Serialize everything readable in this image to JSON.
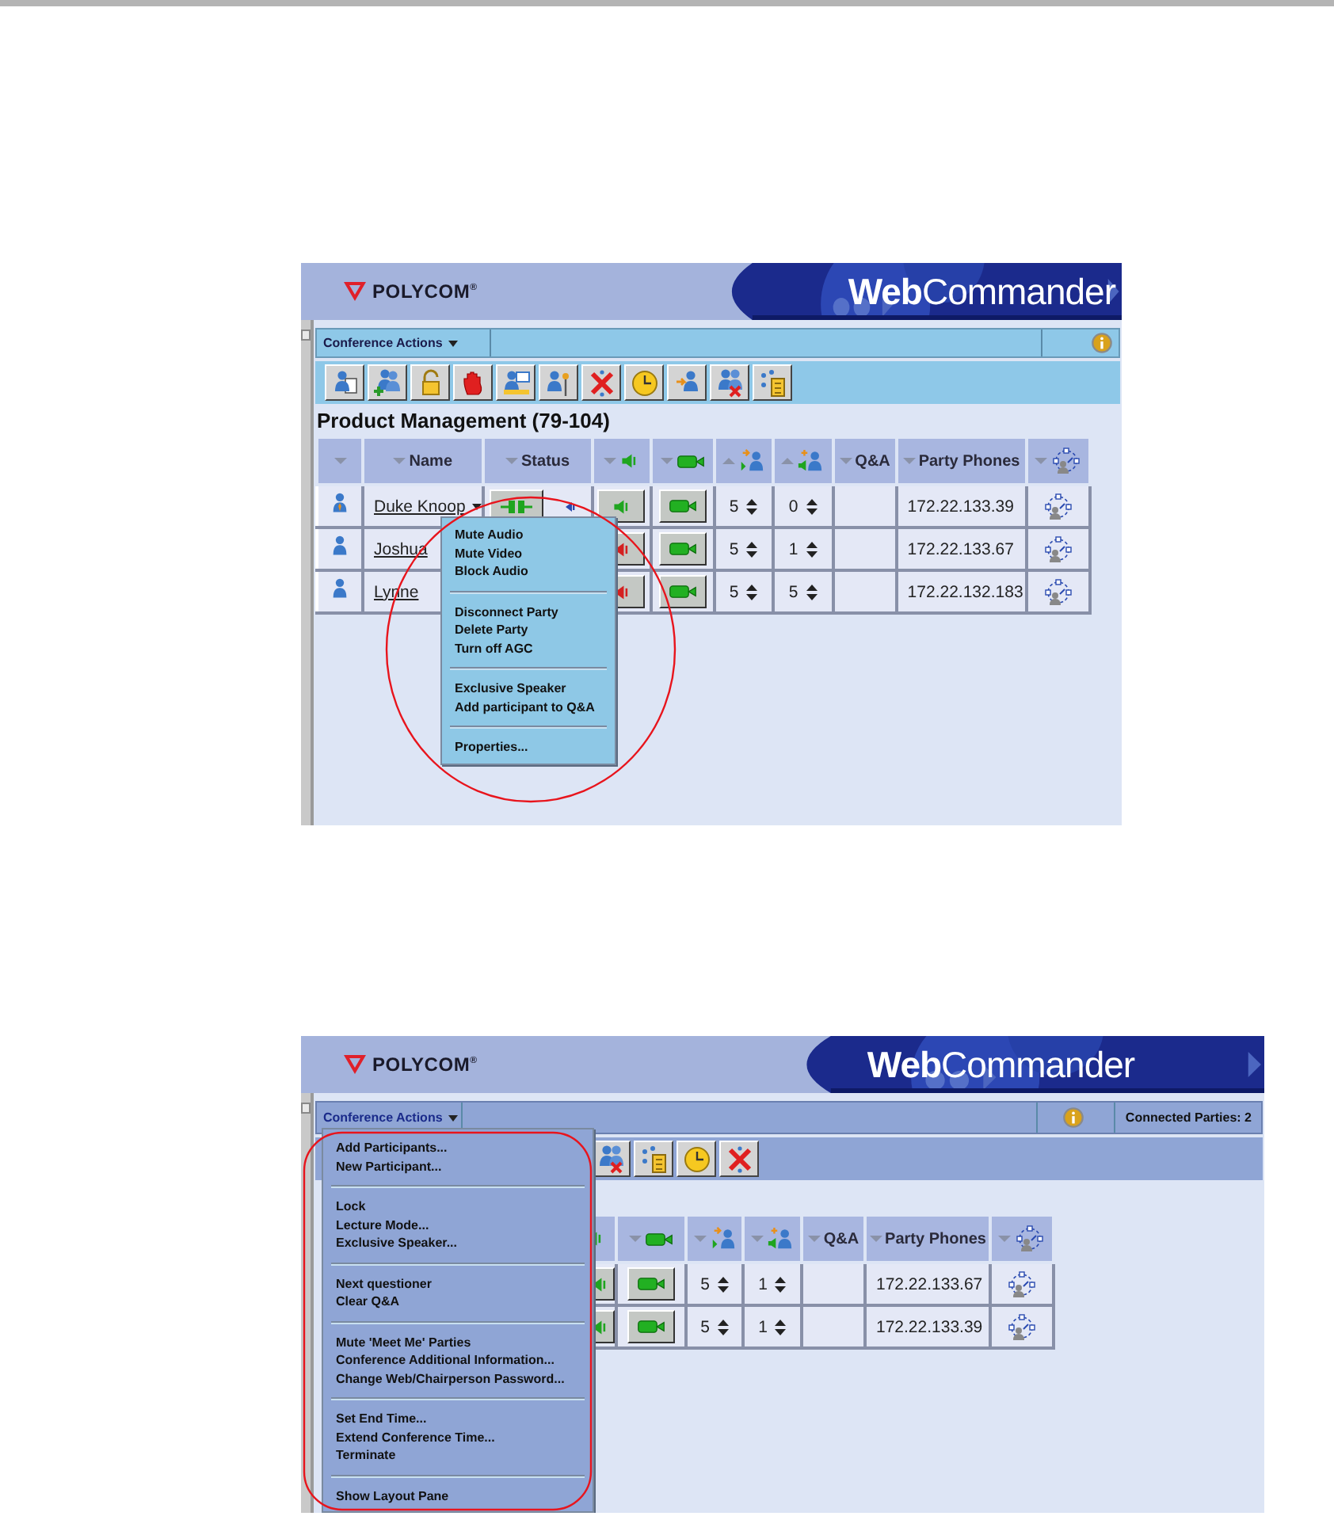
{
  "screenshots": [
    {
      "header": {
        "brand": "POLYCOM$^{®}$",
        "product": "**Web**Commander"
      },
      "actions_bar": {
        "menu_label": "Conference Actions"
      },
      "title": "Product Management (79-104)",
      "table": {
        "columns": [
          {
            "kind": "role",
            "sort_up": false
          },
          {
            "kind": "name",
            "label": "Name",
            "sort_up": false
          },
          {
            "kind": "status",
            "label": "Status",
            "sort_up": false
          },
          {
            "kind": "audio",
            "sort_up": false
          },
          {
            "kind": "video",
            "sort_up": false
          },
          {
            "kind": "rate-in",
            "sort_up": true
          },
          {
            "kind": "rate-out",
            "sort_up": true
          },
          {
            "kind": "qa",
            "label": "Q&A",
            "sort_up": false
          },
          {
            "kind": "phone",
            "label": "Party Phones",
            "sort_up": false
          },
          {
            "kind": "layout",
            "sort_up": false
          }
        ],
        "rows": [
          {
            "cells": [
              {
                "chairperson": true
              },
              {
                "name": "Duke Knoop",
                "menu_open": true
              },
              {
                "connected": true
              },
              {
                "muted": false
              },
              {
                "muted": false
              },
              {
                "value": "5"
              },
              {
                "value": "0"
              },
              {},
              {
                "text": "172.22.133.39"
              },
              {}
            ]
          },
          {
            "cells": [
              {
                "chairperson": false
              },
              {
                "name": "Joshua",
                "menu_open": false
              },
              {},
              {
                "muted": true
              },
              {
                "muted": false
              },
              {
                "value": "5"
              },
              {
                "value": "1"
              },
              {},
              {
                "text": "172.22.133.67"
              },
              {}
            ]
          },
          {
            "cells": [
              {
                "chairperson": false
              },
              {
                "name": "Lynne",
                "menu_open": false
              },
              {},
              {
                "muted": true
              },
              {
                "muted": false
              },
              {
                "value": "5"
              },
              {
                "value": "5"
              },
              {},
              {
                "text": "172.22.132.183"
              },
              {}
            ]
          }
        ]
      },
      "popup_menu": {
        "groups": [
          {
            "items": [
              "Mute Audio",
              "Mute Video",
              "Block Audio"
            ]
          },
          {
            "items": [
              "Disconnect Party",
              "Delete Party",
              "Turn off AGC"
            ]
          },
          {
            "items": [
              "Exclusive Speaker",
              "Add participant to Q&A"
            ]
          },
          {
            "items": [
              "Properties..."
            ]
          }
        ]
      },
      "highlight": {
        "kind": "ellipse"
      }
    },
    {
      "header": {
        "brand": "POLYCOM$^{®}$",
        "product": "**Web**Commander"
      },
      "actions_bar": {
        "menu_label": "Conference Actions",
        "status": "Connected Parties: 2"
      },
      "table": {
        "columns": [
          {
            "kind": "audio"
          },
          {
            "kind": "video",
            "sort_up": false
          },
          {
            "kind": "rate-in",
            "sort_up": false
          },
          {
            "kind": "rate-out",
            "sort_up": false
          },
          {
            "kind": "qa",
            "label": "Q&A",
            "sort_up": false
          },
          {
            "kind": "phone",
            "label": "Party Phones",
            "sort_up": false
          },
          {
            "kind": "layout",
            "sort_up": false
          }
        ],
        "rows": [
          {
            "cells": [
              {
                "muted": false
              },
              {
                "muted": false
              },
              {
                "value": "5"
              },
              {
                "value": "1"
              },
              {},
              {
                "text": "172.22.133.67"
              },
              {}
            ]
          },
          {
            "cells": [
              {
                "muted": false
              },
              {
                "muted": false
              },
              {
                "value": "5"
              },
              {
                "value": "1"
              },
              {},
              {
                "text": "172.22.133.39"
              },
              {}
            ]
          }
        ]
      },
      "popup_menu": {
        "groups": [
          {
            "items": [
              "Add Participants...",
              "New Participant..."
            ]
          },
          {
            "items": [
              "Lock",
              "Lecture Mode...",
              "Exclusive Speaker..."
            ]
          },
          {
            "items": [
              "Next questioner",
              "Clear Q&A"
            ]
          },
          {
            "items": [
              "Mute 'Meet Me' Parties",
              "Conference Additional Information...",
              "Change Web/Chairperson Password..."
            ]
          },
          {
            "items": [
              "Set End Time...",
              "Extend Conference Time...",
              "Terminate"
            ]
          },
          {
            "items": [
              "Show Layout Pane"
            ]
          }
        ]
      },
      "highlight": {
        "kind": "rounded"
      }
    }
  ]
}
